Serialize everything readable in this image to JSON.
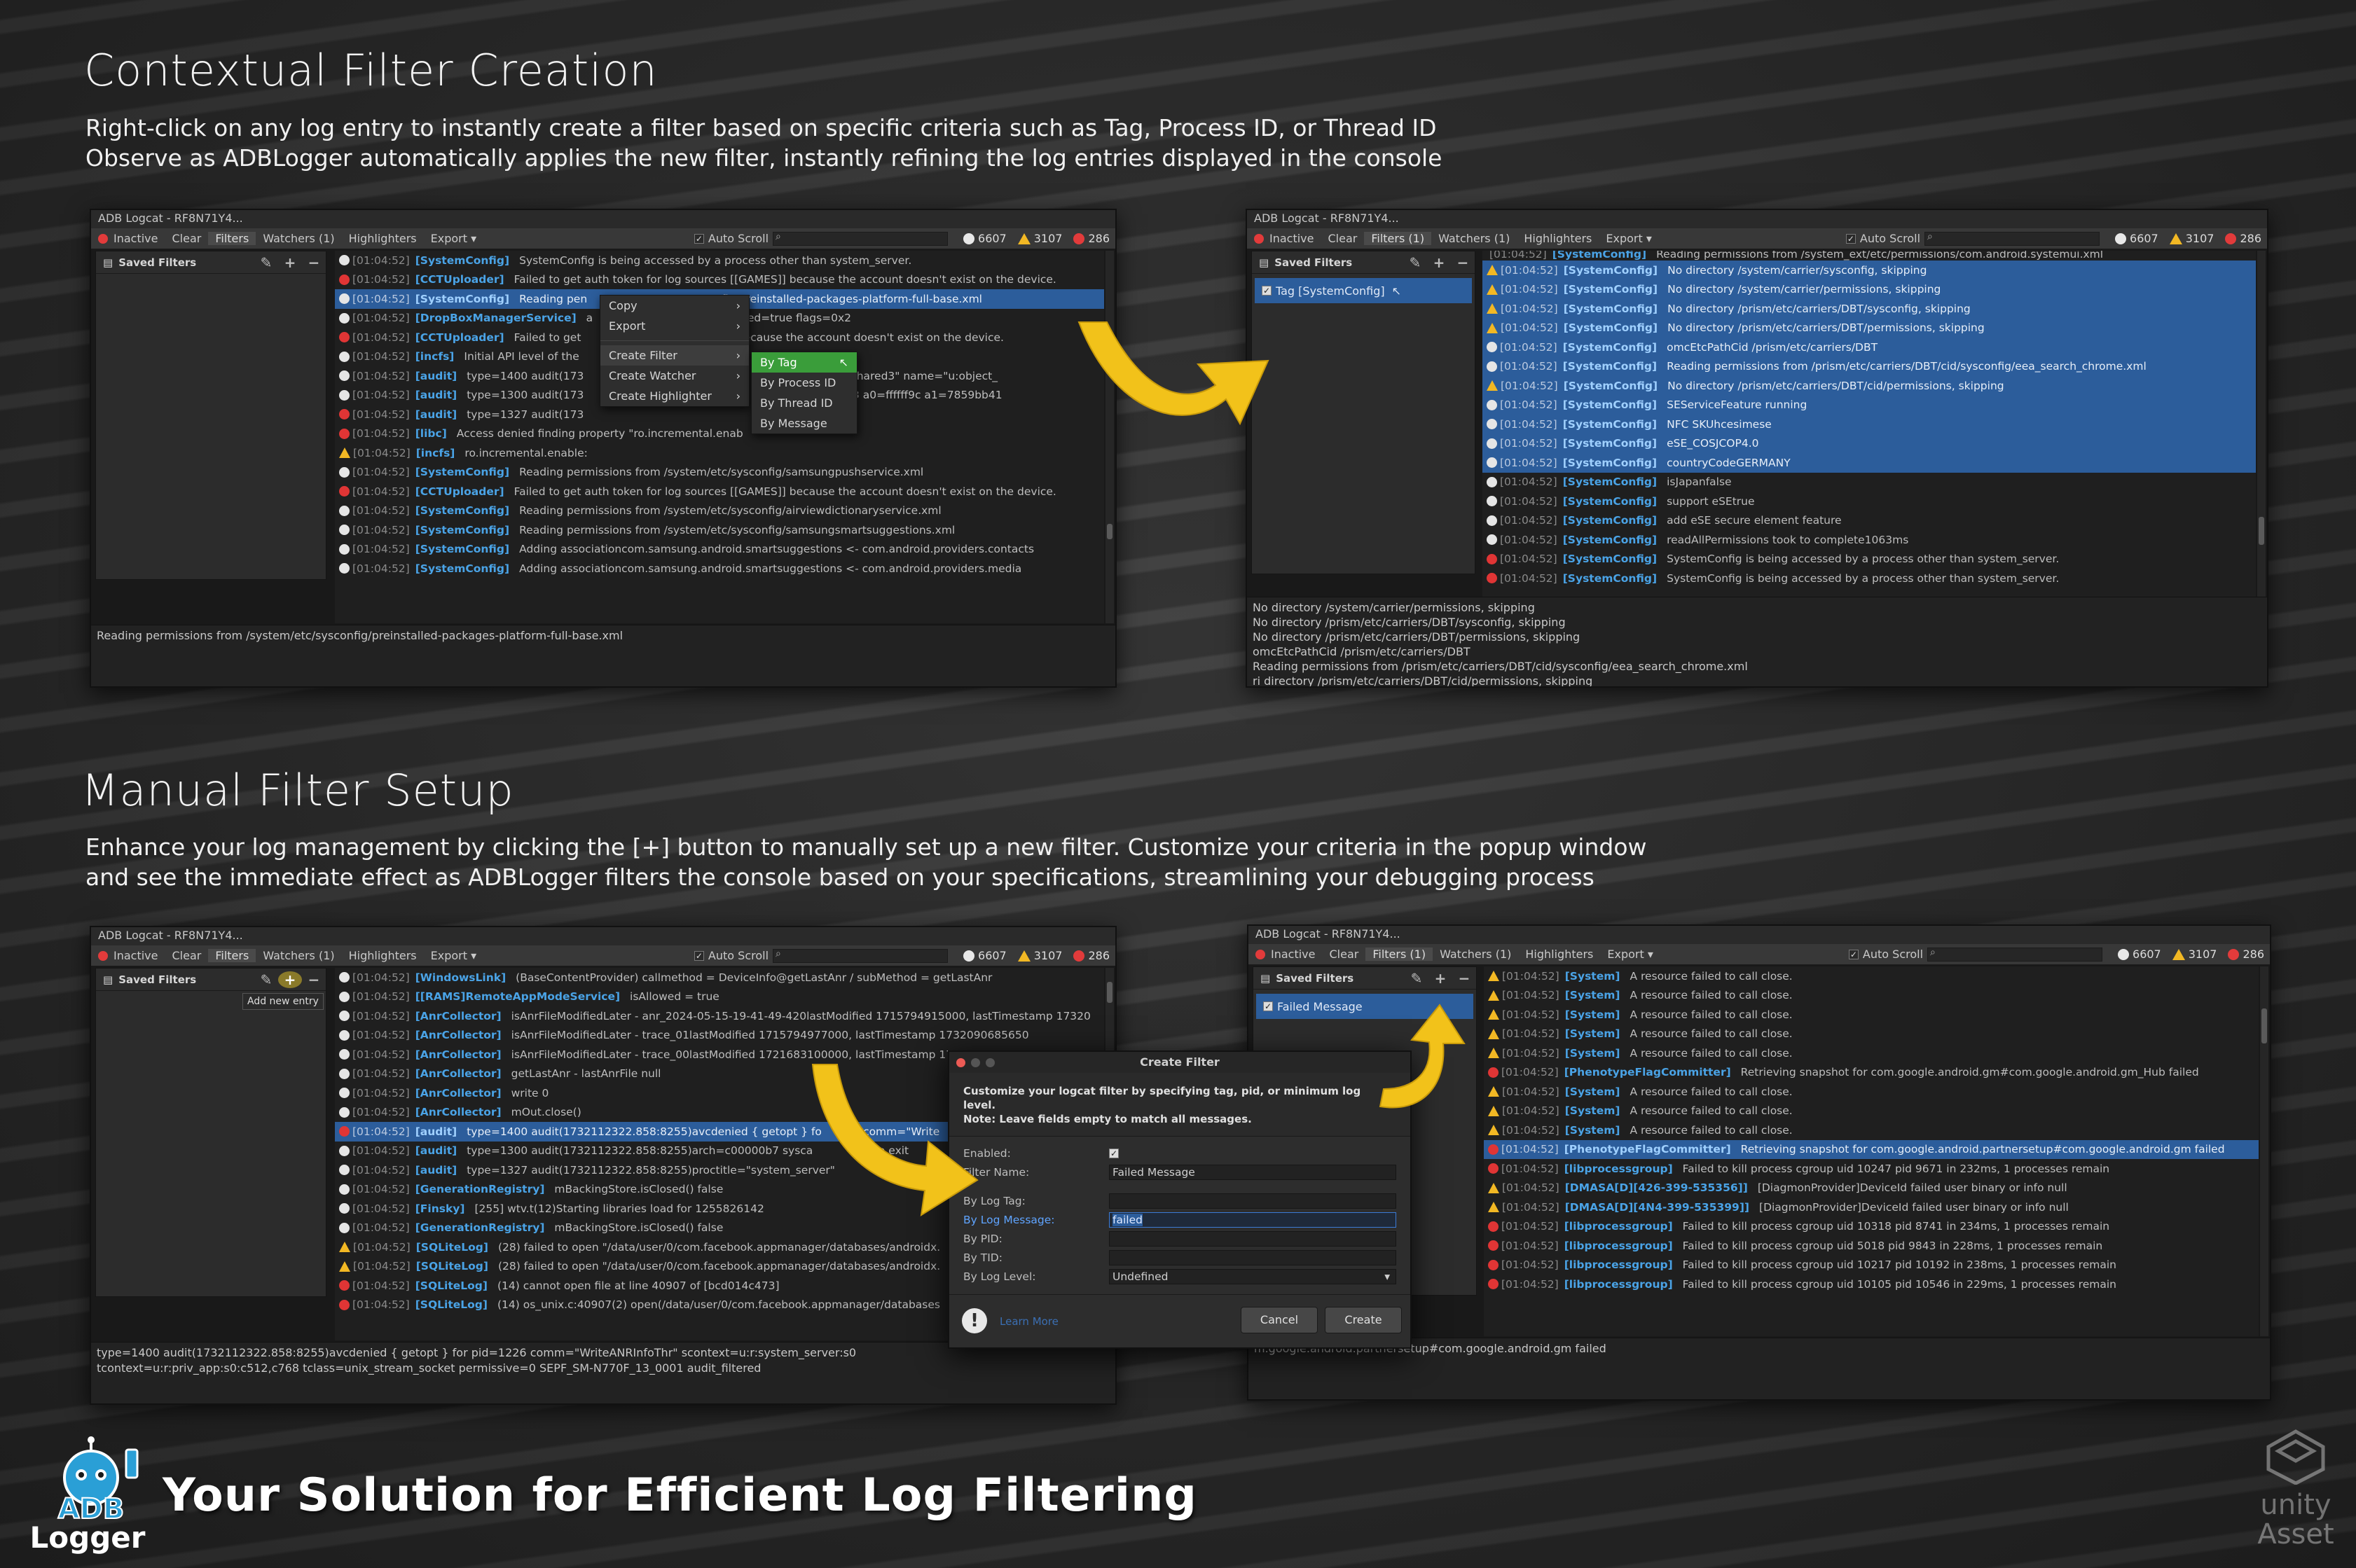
{
  "section1": {
    "title": "Contextual Filter Creation",
    "line1": "Right-click on any log entry to instantly create a filter based on specific criteria such as Tag, Process ID, or Thread ID",
    "line2": "Observe as ADBLogger automatically applies the new filter, instantly refining the log entries displayed in the console"
  },
  "section2": {
    "title": "Manual Filter Setup",
    "line1": "Enhance your log management by clicking the [+] button to manually set up a new filter. Customize your criteria in the popup window",
    "line2": "and see the immediate effect as ADBLogger filters the console based on your specifications, streamlining your debugging process"
  },
  "window_common": {
    "title": "ADB Logcat - RF8N71Y4...",
    "inactive": "Inactive",
    "clear": "Clear",
    "filters": "Filters",
    "filters_one": "Filters (1)",
    "watchers": "Watchers (1)",
    "highlighters": "Highlighters",
    "export": "Export",
    "auto_scroll": "Auto Scroll",
    "info_count": "6607",
    "warn_count": "3107",
    "err_count": "286",
    "saved_filters": "Saved Filters"
  },
  "win1": {
    "rows": [
      {
        "lv": "i",
        "ts": "[01:04:52]",
        "tag": "[SystemConfig]",
        "msg": "SystemConfig is being accessed by a process other than system_server."
      },
      {
        "lv": "e",
        "ts": "[01:04:52]",
        "tag": "[CCTUploader]",
        "msg": "Failed to get auth token for log sources [[GAMES]] because the account doesn't exist on the device."
      },
      {
        "lv": "i",
        "ts": "[01:04:52]",
        "tag": "[SystemConfig]",
        "msg": "Reading pen                                   onfig/preinstalled-packages-platform-full-base.xml",
        "sel": true
      },
      {
        "lv": "i",
        "ts": "[01:04:52]",
        "tag": "[DropBoxManagerService]",
        "msg": "a                                      nabled=true flags=0x2"
      },
      {
        "lv": "e",
        "ts": "[01:04:52]",
        "tag": "[CCTUploader]",
        "msg": "Failed to get                                   MES]] because the account doesn't exist on the device."
      },
      {
        "lv": "i",
        "ts": "[01:04:52]",
        "tag": "[incfs]",
        "msg": "Initial API level of the"
      },
      {
        "lv": "i",
        "ts": "[01:04:52]",
        "tag": "[audit]",
        "msg": "type=1400 audit(173                                                  2 comm=\"Norm_Shared3\" name=\"u:object_"
      },
      {
        "lv": "i",
        "ts": "[01:04:52]",
        "tag": "[audit]",
        "msg": "type=1300 audit(173                                                  ccess=no exit=-13 a0=ffffff9c a1=7859bb41"
      },
      {
        "lv": "e",
        "ts": "[01:04:52]",
        "tag": "[audit]",
        "msg": "type=1327 audit(173                                                  anager\""
      },
      {
        "lv": "e",
        "ts": "[01:04:52]",
        "tag": "[libc]",
        "msg": "Access denied finding property \"ro.incremental.enab"
      },
      {
        "lv": "w",
        "ts": "[01:04:52]",
        "tag": "[incfs]",
        "msg": "ro.incremental.enable:"
      },
      {
        "lv": "i",
        "ts": "[01:04:52]",
        "tag": "[SystemConfig]",
        "msg": "Reading permissions from /system/etc/sysconfig/samsungpushservice.xml"
      },
      {
        "lv": "e",
        "ts": "[01:04:52]",
        "tag": "[CCTUploader]",
        "msg": "Failed to get auth token for log sources [[GAMES]] because the account doesn't exist on the device."
      },
      {
        "lv": "i",
        "ts": "[01:04:52]",
        "tag": "[SystemConfig]",
        "msg": "Reading permissions from /system/etc/sysconfig/airviewdictionaryservice.xml"
      },
      {
        "lv": "i",
        "ts": "[01:04:52]",
        "tag": "[SystemConfig]",
        "msg": "Reading permissions from /system/etc/sysconfig/samsungsmartsuggestions.xml"
      },
      {
        "lv": "i",
        "ts": "[01:04:52]",
        "tag": "[SystemConfig]",
        "msg": "Adding associationcom.samsung.android.smartsuggestions <- com.android.providers.contacts"
      },
      {
        "lv": "i",
        "ts": "[01:04:52]",
        "tag": "[SystemConfig]",
        "msg": "Adding associationcom.samsung.android.smartsuggestions <- com.android.providers.media"
      }
    ],
    "detail": [
      "Reading permissions from /system/etc/sysconfig/preinstalled-packages-platform-full-base.xml"
    ],
    "menu": {
      "copy": "Copy",
      "export": "Export",
      "create_filter": "Create Filter",
      "create_watcher": "Create Watcher",
      "create_highlighter": "Create Highlighter"
    },
    "submenu": {
      "by_tag": "By Tag",
      "by_pid": "By Process ID",
      "by_tid": "By Thread ID",
      "by_msg": "By Message"
    }
  },
  "win2": {
    "filter_item": "Tag [SystemConfig]",
    "top_partial": "Reading permissions from /system_ext/etc/permissions/com.android.systemui.xml",
    "rows": [
      {
        "lv": "w",
        "ts": "[01:04:52]",
        "tag": "[SystemConfig]",
        "msg": "No directory /system/carrier/sysconfig, skipping",
        "sel": true
      },
      {
        "lv": "w",
        "ts": "[01:04:52]",
        "tag": "[SystemConfig]",
        "msg": "No directory /system/carrier/permissions, skipping",
        "sel": true
      },
      {
        "lv": "w",
        "ts": "[01:04:52]",
        "tag": "[SystemConfig]",
        "msg": "No directory /prism/etc/carriers/DBT/sysconfig, skipping",
        "sel": true
      },
      {
        "lv": "w",
        "ts": "[01:04:52]",
        "tag": "[SystemConfig]",
        "msg": "No directory /prism/etc/carriers/DBT/permissions, skipping",
        "sel": true
      },
      {
        "lv": "i",
        "ts": "[01:04:52]",
        "tag": "[SystemConfig]",
        "msg": "omcEtcPathCid /prism/etc/carriers/DBT",
        "sel": true
      },
      {
        "lv": "i",
        "ts": "[01:04:52]",
        "tag": "[SystemConfig]",
        "msg": "Reading permissions from /prism/etc/carriers/DBT/cid/sysconfig/eea_search_chrome.xml",
        "sel": true
      },
      {
        "lv": "w",
        "ts": "[01:04:52]",
        "tag": "[SystemConfig]",
        "msg": "No directory /prism/etc/carriers/DBT/cid/permissions, skipping",
        "sel": true
      },
      {
        "lv": "i",
        "ts": "[01:04:52]",
        "tag": "[SystemConfig]",
        "msg": "SEServiceFeature running",
        "sel": true
      },
      {
        "lv": "i",
        "ts": "[01:04:52]",
        "tag": "[SystemConfig]",
        "msg": "NFC SKUhcesimese",
        "sel": true
      },
      {
        "lv": "i",
        "ts": "[01:04:52]",
        "tag": "[SystemConfig]",
        "msg": "eSE_COSJCOP4.0",
        "sel": true
      },
      {
        "lv": "i",
        "ts": "[01:04:52]",
        "tag": "[SystemConfig]",
        "msg": "countryCodeGERMANY",
        "sel": true
      },
      {
        "lv": "i",
        "ts": "[01:04:52]",
        "tag": "[SystemConfig]",
        "msg": "isJapanfalse"
      },
      {
        "lv": "i",
        "ts": "[01:04:52]",
        "tag": "[SystemConfig]",
        "msg": "support eSEtrue"
      },
      {
        "lv": "i",
        "ts": "[01:04:52]",
        "tag": "[SystemConfig]",
        "msg": "add eSE secure element feature"
      },
      {
        "lv": "i",
        "ts": "[01:04:52]",
        "tag": "[SystemConfig]",
        "msg": "readAllPermissions took to complete1063ms"
      },
      {
        "lv": "e",
        "ts": "[01:04:52]",
        "tag": "[SystemConfig]",
        "msg": "SystemConfig is being accessed by a process other than system_server."
      },
      {
        "lv": "e",
        "ts": "[01:04:52]",
        "tag": "[SystemConfig]",
        "msg": "SystemConfig is being accessed by a process other than system_server."
      }
    ],
    "detail": [
      "No directory /system/carrier/permissions, skipping",
      "No directory /prism/etc/carriers/DBT/sysconfig, skipping",
      "No directory /prism/etc/carriers/DBT/permissions, skipping",
      "omcEtcPathCid /prism/etc/carriers/DBT",
      "Reading permissions from /prism/etc/carriers/DBT/cid/sysconfig/eea_search_chrome.xml",
      "ri    directory /prism/etc/carriers/DBT/cid/permissions, skipping"
    ]
  },
  "win3": {
    "tooltip": "Add new entry",
    "rows": [
      {
        "lv": "i",
        "ts": "[01:04:52]",
        "tag": "[WindowsLink]",
        "msg": "(BaseContentProvider) callmethod = DeviceInfo@getLastAnr / subMethod = getLastAnr"
      },
      {
        "lv": "i",
        "ts": "[01:04:52]",
        "tag": "[[RAMS]RemoteAppModeService]",
        "msg": "isAllowed = true"
      },
      {
        "lv": "i",
        "ts": "[01:04:52]",
        "tag": "[AnrCollector]",
        "msg": "isAnrFileModifiedLater - anr_2024-05-15-19-41-49-420lastModified 1715794915000, lastTimestamp 17320"
      },
      {
        "lv": "i",
        "ts": "[01:04:52]",
        "tag": "[AnrCollector]",
        "msg": "isAnrFileModifiedLater - trace_01lastModified 1715794977000, lastTimestamp 1732090685650"
      },
      {
        "lv": "i",
        "ts": "[01:04:52]",
        "tag": "[AnrCollector]",
        "msg": "isAnrFileModifiedLater - trace_00lastModified 1721683100000, lastTimestamp 1732090685650"
      },
      {
        "lv": "i",
        "ts": "[01:04:52]",
        "tag": "[AnrCollector]",
        "msg": "getLastAnr - lastAnrFile null"
      },
      {
        "lv": "i",
        "ts": "[01:04:52]",
        "tag": "[AnrCollector]",
        "msg": "write 0"
      },
      {
        "lv": "i",
        "ts": "[01:04:52]",
        "tag": "[AnrCollector]",
        "msg": "mOut.close()"
      },
      {
        "lv": "e",
        "ts": "[01:04:52]",
        "tag": "[audit]",
        "msg": "type=1400 audit(1732112322.858:8255)avcdenied { getopt } fo            comm=\"Write",
        "sel": true
      },
      {
        "lv": "i",
        "ts": "[01:04:52]",
        "tag": "[audit]",
        "msg": "type=1300 audit(1732112322.858:8255)arch=c00000b7 sysca                   o exit"
      },
      {
        "lv": "i",
        "ts": "[01:04:52]",
        "tag": "[audit]",
        "msg": "type=1327 audit(1732112322.858:8255)proctitle=\"system_server\""
      },
      {
        "lv": "i",
        "ts": "[01:04:52]",
        "tag": "[GenerationRegistry]",
        "msg": "mBackingStore.isClosed() false"
      },
      {
        "lv": "i",
        "ts": "[01:04:52]",
        "tag": "[Finsky]",
        "msg": "[255] wtv.t(12)Starting libraries load for 1255826142"
      },
      {
        "lv": "i",
        "ts": "[01:04:52]",
        "tag": "[GenerationRegistry]",
        "msg": "mBackingStore.isClosed() false"
      },
      {
        "lv": "w",
        "ts": "[01:04:52]",
        "tag": "[SQLiteLog]",
        "msg": "(28) failed to open \"/data/user/0/com.facebook.appmanager/databases/androidx."
      },
      {
        "lv": "w",
        "ts": "[01:04:52]",
        "tag": "[SQLiteLog]",
        "msg": "(28) failed to open \"/data/user/0/com.facebook.appmanager/databases/androidx."
      },
      {
        "lv": "e",
        "ts": "[01:04:52]",
        "tag": "[SQLiteLog]",
        "msg": "(14) cannot open file at line 40907 of [bcd014c473]"
      },
      {
        "lv": "e",
        "ts": "[01:04:52]",
        "tag": "[SQLiteLog]",
        "msg": "(14) os_unix.c:40907(2) open(/data/user/0/com.facebook.appmanager/databases"
      }
    ],
    "detail": [
      "type=1400 audit(1732112322.858:8255)avcdenied { getopt } for pid=1226 comm=\"WriteANRInfoThr\" scontext=u:r:system_server:s0",
      "tcontext=u:r:priv_app:s0:c512,c768 tclass=unix_stream_socket permissive=0 SEPF_SM-N770F_13_0001 audit_filtered"
    ]
  },
  "dialog": {
    "title": "Create Filter",
    "intro1": "Customize your logcat filter by specifying tag, pid, or minimum log level.",
    "intro2": "Note: Leave fields empty to match all messages.",
    "enabled_label": "Enabled:",
    "filter_name_label": "Filter Name:",
    "filter_name_value": "Failed Message",
    "by_tag_label": "By Log Tag:",
    "by_tag_value": "",
    "by_msg_label": "By Log Message:",
    "by_msg_value": "failed",
    "by_pid_label": "By PID:",
    "by_tid_label": "By TID:",
    "by_level_label": "By Log Level:",
    "by_level_value": "Undefined",
    "learn_more": "Learn More",
    "cancel": "Cancel",
    "create": "Create"
  },
  "win4": {
    "filter_item": "Failed Message",
    "rows": [
      {
        "lv": "w",
        "ts": "[01:04:52]",
        "tag": "[System]",
        "msg": "A resource failed to call close."
      },
      {
        "lv": "w",
        "ts": "[01:04:52]",
        "tag": "[System]",
        "msg": "A resource failed to call close."
      },
      {
        "lv": "w",
        "ts": "[01:04:52]",
        "tag": "[System]",
        "msg": "A resource failed to call close."
      },
      {
        "lv": "w",
        "ts": "[01:04:52]",
        "tag": "[System]",
        "msg": "A resource failed to call close."
      },
      {
        "lv": "w",
        "ts": "[01:04:52]",
        "tag": "[System]",
        "msg": "A resource failed to call close."
      },
      {
        "lv": "e",
        "ts": "[01:04:52]",
        "tag": "[PhenotypeFlagCommitter]",
        "msg": "Retrieving snapshot for com.google.android.gm#com.google.android.gm_Hub failed"
      },
      {
        "lv": "w",
        "ts": "[01:04:52]",
        "tag": "[System]",
        "msg": "A resource failed to call close."
      },
      {
        "lv": "w",
        "ts": "[01:04:52]",
        "tag": "[System]",
        "msg": "A resource failed to call close."
      },
      {
        "lv": "w",
        "ts": "[01:04:52]",
        "tag": "[System]",
        "msg": "A resource failed to call close."
      },
      {
        "lv": "e",
        "ts": "[01:04:52]",
        "tag": "[PhenotypeFlagCommitter]",
        "msg": "Retrieving snapshot for com.google.android.partnersetup#com.google.android.gm failed",
        "sel": true
      },
      {
        "lv": "e",
        "ts": "[01:04:52]",
        "tag": "[libprocessgroup]",
        "msg": "Failed to kill process cgroup uid 10247 pid 9671 in 232ms, 1 processes remain"
      },
      {
        "lv": "w",
        "ts": "[01:04:52]",
        "tag": "[DMASA[D][426-399-535356]]",
        "msg": "[DiagmonProvider]DeviceId failed user binary or info null"
      },
      {
        "lv": "w",
        "ts": "[01:04:52]",
        "tag": "[DMASA[D][4N4-399-535399]]",
        "msg": "[DiagmonProvider]DeviceId failed user binary or info null"
      },
      {
        "lv": "e",
        "ts": "[01:04:52]",
        "tag": "[libprocessgroup]",
        "msg": "Failed to kill process cgroup uid 10318 pid 8741 in 234ms, 1 processes remain"
      },
      {
        "lv": "e",
        "ts": "[01:04:52]",
        "tag": "[libprocessgroup]",
        "msg": "Failed to kill process cgroup uid 5018 pid 9843 in 228ms, 1 processes remain"
      },
      {
        "lv": "e",
        "ts": "[01:04:52]",
        "tag": "[libprocessgroup]",
        "msg": "Failed to kill process cgroup uid 10217 pid 10192 in 238ms, 1 processes remain"
      },
      {
        "lv": "e",
        "ts": "[01:04:52]",
        "tag": "[libprocessgroup]",
        "msg": "Failed to kill process cgroup uid 10105 pid 10546 in 229ms, 1 processes remain"
      }
    ],
    "detail": [
      "m.google.android.partnersetup#com.google.android.gm failed"
    ]
  },
  "footer": {
    "tagline": "Your Solution for Efficient Log Filtering",
    "logo_line1": "ADB",
    "logo_line2": "Logger",
    "unity_line1": "unity",
    "unity_line2": "Asset"
  },
  "colors": {
    "accent": "#2c5d9b",
    "tag_blue": "#4aa3e6",
    "warn": "#f2b824",
    "error": "#e03535",
    "arrow": "#f2c21a",
    "menu_green": "#3a9d3a"
  }
}
